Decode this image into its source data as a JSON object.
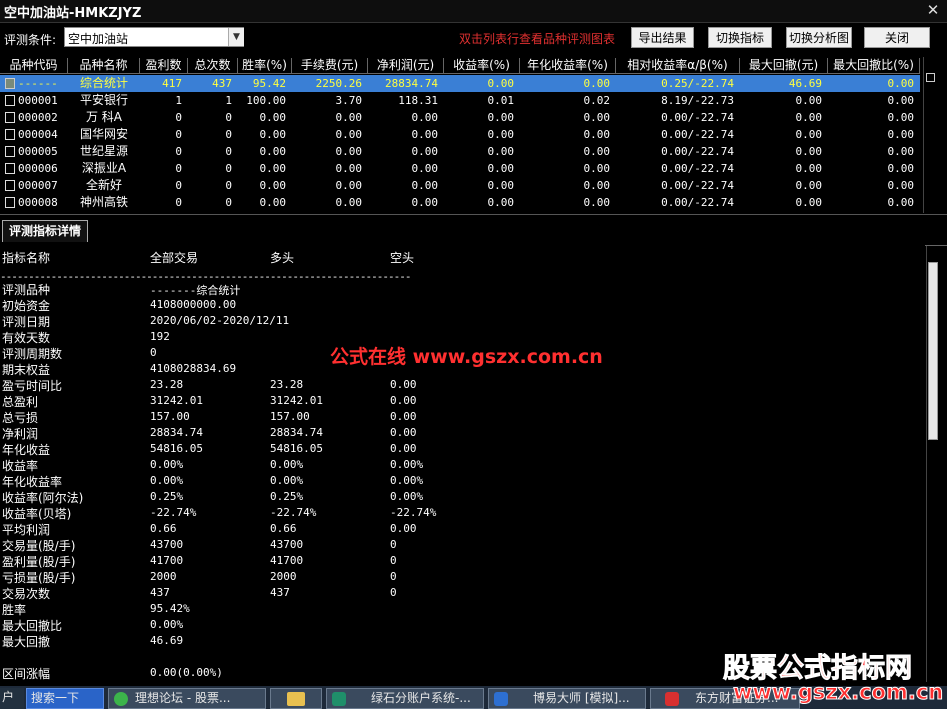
{
  "window": {
    "title": "空中加油站-HMKZJYZ",
    "close": "✕"
  },
  "toolbar": {
    "condition_label": "评测条件:",
    "condition_value": "空中加油站",
    "hint": "双击列表行查看品种评测图表",
    "buttons": [
      "导出结果",
      "切换指标",
      "切换分析图",
      "关闭"
    ]
  },
  "table": {
    "headers": [
      "品种代码",
      "品种名称",
      "盈利数",
      "总次数",
      "胜率(%)",
      "手续费(元)",
      "净利润(元)",
      "收益率(%)",
      "年化收益率(%)",
      "相对收益率α/β(%)",
      "最大回撤(元)",
      "最大回撤比(%)"
    ],
    "rows": [
      [
        "------",
        "综合统计",
        "417",
        "437",
        "95.42",
        "2250.26",
        "28834.74",
        "0.00",
        "0.00",
        "0.25/-22.74",
        "46.69",
        "0.00"
      ],
      [
        "000001",
        "平安银行",
        "1",
        "1",
        "100.00",
        "3.70",
        "118.31",
        "0.01",
        "0.02",
        "8.19/-22.73",
        "0.00",
        "0.00"
      ],
      [
        "000002",
        "万 科A",
        "0",
        "0",
        "0.00",
        "0.00",
        "0.00",
        "0.00",
        "0.00",
        "0.00/-22.74",
        "0.00",
        "0.00"
      ],
      [
        "000004",
        "国华网安",
        "0",
        "0",
        "0.00",
        "0.00",
        "0.00",
        "0.00",
        "0.00",
        "0.00/-22.74",
        "0.00",
        "0.00"
      ],
      [
        "000005",
        "世纪星源",
        "0",
        "0",
        "0.00",
        "0.00",
        "0.00",
        "0.00",
        "0.00",
        "0.00/-22.74",
        "0.00",
        "0.00"
      ],
      [
        "000006",
        "深振业A",
        "0",
        "0",
        "0.00",
        "0.00",
        "0.00",
        "0.00",
        "0.00",
        "0.00/-22.74",
        "0.00",
        "0.00"
      ],
      [
        "000007",
        "全新好",
        "0",
        "0",
        "0.00",
        "0.00",
        "0.00",
        "0.00",
        "0.00",
        "0.00/-22.74",
        "0.00",
        "0.00"
      ],
      [
        "000008",
        "神州高铁",
        "0",
        "0",
        "0.00",
        "0.00",
        "0.00",
        "0.00",
        "0.00",
        "0.00/-22.74",
        "0.00",
        "0.00"
      ]
    ]
  },
  "detail": {
    "tab": "评测指标详情",
    "col_headers": [
      "指标名称",
      "全部交易",
      "多头",
      "空头"
    ],
    "separator": "-------------------------------------------------------------------------",
    "rows": [
      [
        "评测品种",
        "-------综合统计",
        "",
        ""
      ],
      [
        "初始资金",
        "4108000000.00",
        "",
        ""
      ],
      [
        "评测日期",
        "2020/06/02-2020/12/11",
        "",
        ""
      ],
      [
        "有效天数",
        "192",
        "",
        ""
      ],
      [
        "评测周期数",
        "0",
        "",
        ""
      ],
      [
        "期末权益",
        "4108028834.69",
        "",
        ""
      ],
      [
        "盈亏时间比",
        "23.28",
        "23.28",
        "0.00"
      ],
      [
        "总盈利",
        "31242.01",
        "31242.01",
        "0.00"
      ],
      [
        "总亏损",
        "157.00",
        "157.00",
        "0.00"
      ],
      [
        "净利润",
        "28834.74",
        "28834.74",
        "0.00"
      ],
      [
        "年化收益",
        "54816.05",
        "54816.05",
        "0.00"
      ],
      [
        "收益率",
        "0.00%",
        "0.00%",
        "0.00%"
      ],
      [
        "年化收益率",
        "0.00%",
        "0.00%",
        "0.00%"
      ],
      [
        "收益率(阿尔法)",
        "0.25%",
        "0.25%",
        "0.00%"
      ],
      [
        "收益率(贝塔)",
        "-22.74%",
        "-22.74%",
        "-22.74%"
      ],
      [
        "平均利润",
        "0.66",
        "0.66",
        "0.00"
      ],
      [
        "交易量(股/手)",
        "43700",
        "43700",
        "0"
      ],
      [
        "盈利量(股/手)",
        "41700",
        "41700",
        "0"
      ],
      [
        "亏损量(股/手)",
        "2000",
        "2000",
        "0"
      ],
      [
        "交易次数",
        "437",
        "437",
        "0"
      ],
      [
        "胜率",
        "95.42%",
        "",
        ""
      ],
      [
        "最大回撤比",
        "0.00%",
        "",
        ""
      ],
      [
        "最大回撤",
        "46.69",
        "",
        ""
      ]
    ],
    "range_label": "区间涨幅",
    "range_value": "0.00(0.00%)"
  },
  "watermarks": {
    "center": "公式在线 www.gszx.com.cn",
    "corner_line1": "股票公式指标网",
    "corner_line2": "www.gszx.com.cn"
  },
  "taskbar": {
    "items": [
      "户",
      "搜索一下",
      "理想论坛 - 股票...",
      "",
      "绿石分账户系统-...",
      "博易大师 [模拟]...",
      "东方财富证券..."
    ]
  },
  "colors": {
    "selection": "#3a7fd5",
    "accent_red": "#ff3030",
    "hint_red": "#e03030"
  }
}
